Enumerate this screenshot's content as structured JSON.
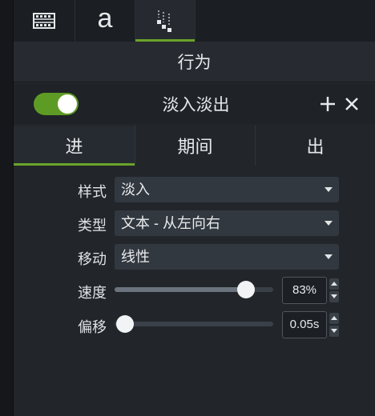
{
  "top_tabs": [
    {
      "icon": "film-icon"
    },
    {
      "icon": "text-icon",
      "glyph": "a"
    },
    {
      "icon": "behaviors-icon"
    },
    {
      "icon": "blank"
    }
  ],
  "section": {
    "title": "行为"
  },
  "behavior": {
    "name": "淡入淡出",
    "enabled": true,
    "add_icon": "plus-icon",
    "remove_icon": "close-icon"
  },
  "phase_tabs": {
    "items": [
      "进",
      "期间",
      "出"
    ],
    "active": "进"
  },
  "properties": {
    "style": {
      "label": "样式",
      "value": "淡入"
    },
    "type": {
      "label": "类型",
      "value": "文本 - 从左向右"
    },
    "movement": {
      "label": "移动",
      "value": "线性"
    },
    "speed": {
      "label": "速度",
      "value_text": "83%",
      "fraction": 0.83
    },
    "offset": {
      "label": "偏移",
      "value_text": "0.05s",
      "fraction": 0.0
    }
  },
  "colors": {
    "accent": "#6aa329",
    "toggle_on": "#5e9b24"
  }
}
